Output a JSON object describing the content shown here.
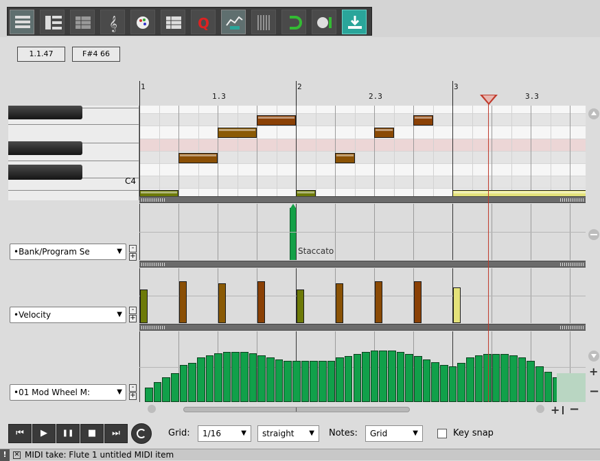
{
  "toolbar": {
    "buttons": [
      {
        "name": "piano-roll-view-icon",
        "on": true
      },
      {
        "name": "named-notes-view-icon",
        "on": false
      },
      {
        "name": "event-list-view-icon",
        "on": false
      },
      {
        "name": "notation-view-icon",
        "on": false
      },
      {
        "name": "color-notes-icon",
        "on": false
      },
      {
        "name": "filter-events-icon",
        "on": false
      },
      {
        "name": "quantize-icon",
        "on": false
      },
      {
        "name": "cc-curve-icon",
        "on": true
      },
      {
        "name": "grid-lines-icon",
        "on": false
      },
      {
        "name": "snap-magnet-icon",
        "on": false
      },
      {
        "name": "show-all-takes-icon",
        "on": false
      },
      {
        "name": "step-input-icon",
        "on": false,
        "highlight": true
      }
    ]
  },
  "position": {
    "time": "1.1.47",
    "note": "F#4  66"
  },
  "ruler": {
    "marks": [
      {
        "label": "1",
        "major": true
      },
      {
        "label": "1.3",
        "major": false
      },
      {
        "label": "2",
        "major": true
      },
      {
        "label": "2.3",
        "major": false
      },
      {
        "label": "3",
        "major": true
      },
      {
        "label": "3.3",
        "major": false
      }
    ]
  },
  "keys": {
    "c4_label": "C4"
  },
  "notes": [
    {
      "pitch": 60,
      "start": 0,
      "len": 2,
      "color": "#6d7a08"
    },
    {
      "pitch": 63,
      "start": 2,
      "len": 2,
      "color": "#8a4f05"
    },
    {
      "pitch": 65,
      "start": 4,
      "len": 2,
      "color": "#8a5a05"
    },
    {
      "pitch": 66,
      "start": 6,
      "len": 2,
      "color": "#8a4005"
    },
    {
      "pitch": 60,
      "start": 8,
      "len": 1,
      "color": "#6d7a08"
    },
    {
      "pitch": 63,
      "start": 10,
      "len": 1,
      "color": "#8a5205"
    },
    {
      "pitch": 65,
      "start": 12,
      "len": 1,
      "color": "#8a4a05"
    },
    {
      "pitch": 66,
      "start": 14,
      "len": 1,
      "color": "#8a4005"
    },
    {
      "pitch": 60,
      "start": 16,
      "len": 7.3,
      "color": "#e4e27a"
    }
  ],
  "lanes": {
    "bank_program": {
      "label": "•Bank/Program Se",
      "event_text": "Staccato"
    },
    "velocity": {
      "label": "•Velocity"
    },
    "modwheel": {
      "label": "•01 Mod Wheel M:"
    }
  },
  "velocities": [
    80,
    100,
    95,
    100,
    80,
    95,
    100,
    100,
    85
  ],
  "modwheel_values": [
    20,
    28,
    35,
    40,
    52,
    55,
    62,
    65,
    68,
    70,
    70,
    70,
    68,
    65,
    62,
    60,
    58,
    58,
    58,
    58,
    58,
    58,
    62,
    64,
    67,
    70,
    72,
    72,
    72,
    70,
    67,
    64,
    60,
    56,
    52,
    50,
    55,
    62,
    65,
    67,
    67,
    67,
    65,
    62,
    58,
    50,
    42,
    35
  ],
  "transport": {
    "rewind": "⏮",
    "play": "▶",
    "pause": "❚❚",
    "stop": "■",
    "forward": "⏭"
  },
  "controls": {
    "grid_label": "Grid:",
    "grid_value": "1/16",
    "swing_value": "straight",
    "notes_label": "Notes:",
    "notes_value": "Grid",
    "key_snap_label": "Key snap"
  },
  "status": {
    "text": "MIDI take: Flute 1 untitled MIDI item",
    "bang": "!"
  }
}
